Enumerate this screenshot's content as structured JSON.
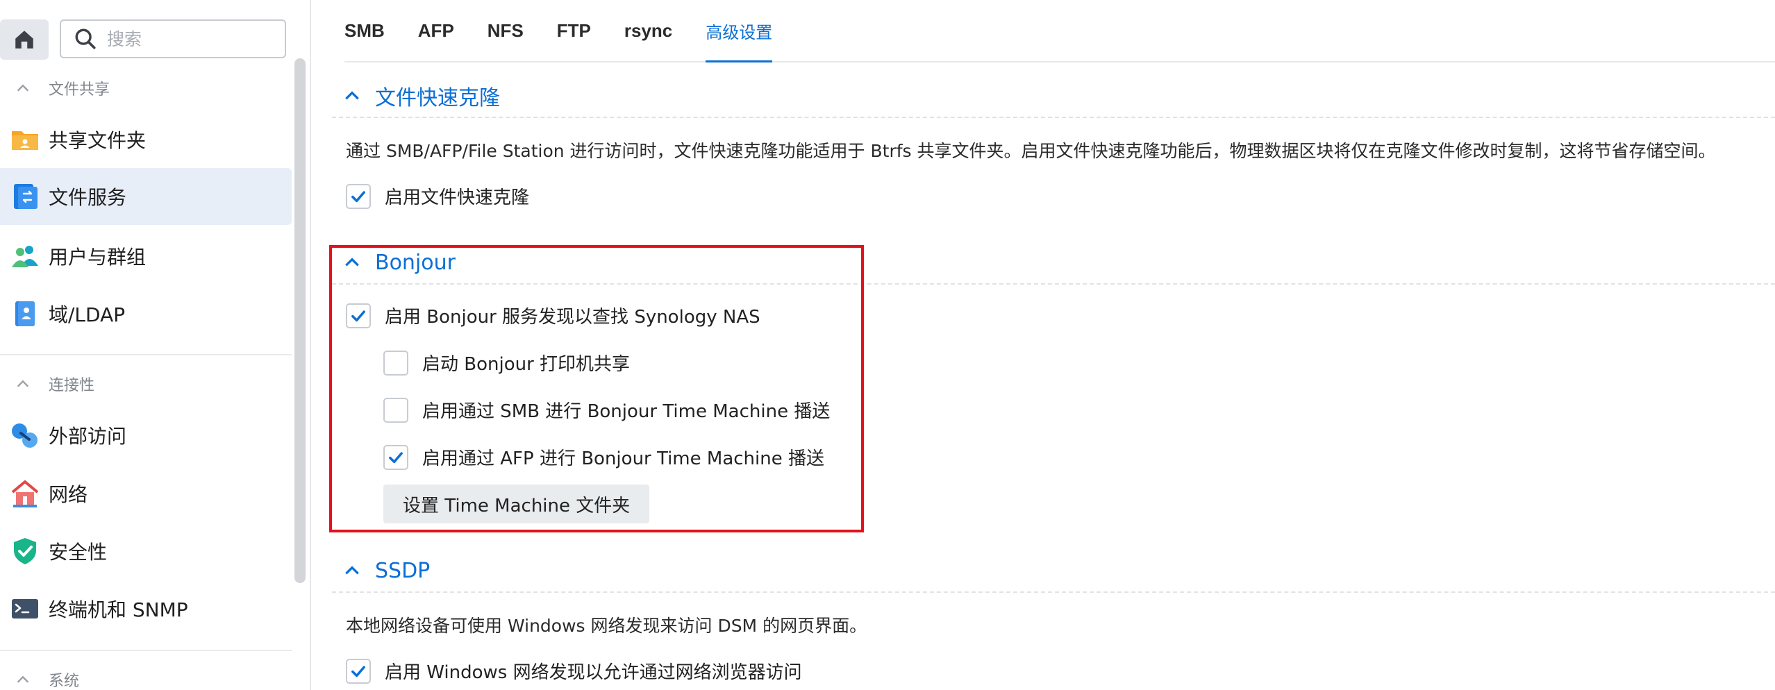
{
  "sidebar": {
    "home_icon": "home-icon",
    "search_placeholder": "搜索",
    "sections": [
      {
        "title": "文件共享"
      },
      {
        "title": "连接性"
      },
      {
        "title": "系统"
      }
    ],
    "items": [
      {
        "label": "共享文件夹",
        "icon": "shared-folder-icon"
      },
      {
        "label": "文件服务",
        "icon": "file-services-icon",
        "active": true
      },
      {
        "label": "用户与群组",
        "icon": "users-groups-icon"
      },
      {
        "label": "域/LDAP",
        "icon": "domain-ldap-icon"
      },
      {
        "label": "外部访问",
        "icon": "external-access-icon"
      },
      {
        "label": "网络",
        "icon": "network-icon"
      },
      {
        "label": "安全性",
        "icon": "security-shield-icon"
      },
      {
        "label": "终端机和 SNMP",
        "icon": "terminal-snmp-icon"
      }
    ]
  },
  "tabs": [
    {
      "label": "SMB"
    },
    {
      "label": "AFP"
    },
    {
      "label": "NFS"
    },
    {
      "label": "FTP"
    },
    {
      "label": "rsync"
    },
    {
      "label": "高级设置",
      "active": true
    }
  ],
  "groups": {
    "fast_clone": {
      "title": "文件快速克隆",
      "description": "通过 SMB/AFP/File Station 进行访问时，文件快速克隆功能适用于 Btrfs 共享文件夹。启用文件快速克隆功能后，物理数据区块将仅在克隆文件修改时复制，这将节省存储空间。",
      "checkbox_label": "启用文件快速克隆",
      "checked": true
    },
    "bonjour": {
      "title": "Bonjour",
      "main_checkbox": {
        "label": "启用 Bonjour 服务发现以查找 Synology NAS",
        "checked": true
      },
      "sub_checkboxes": [
        {
          "label": "启动 Bonjour 打印机共享",
          "checked": false
        },
        {
          "label": "启用通过 SMB 进行 Bonjour Time Machine 播送",
          "checked": false
        },
        {
          "label": "启用通过 AFP 进行 Bonjour Time Machine 播送",
          "checked": true
        }
      ],
      "button_label": "设置 Time Machine 文件夹"
    },
    "ssdp": {
      "title": "SSDP",
      "description": "本地网络设备可使用 Windows 网络发现来访问 DSM 的网页界面。",
      "checkbox_label": "启用 Windows 网络发现以允许通过网络浏览器访问",
      "checked": true
    }
  },
  "colors": {
    "accent": "#0a6fd6",
    "highlight_box": "#e3121a",
    "active_nav_bg": "#e8eef8"
  }
}
